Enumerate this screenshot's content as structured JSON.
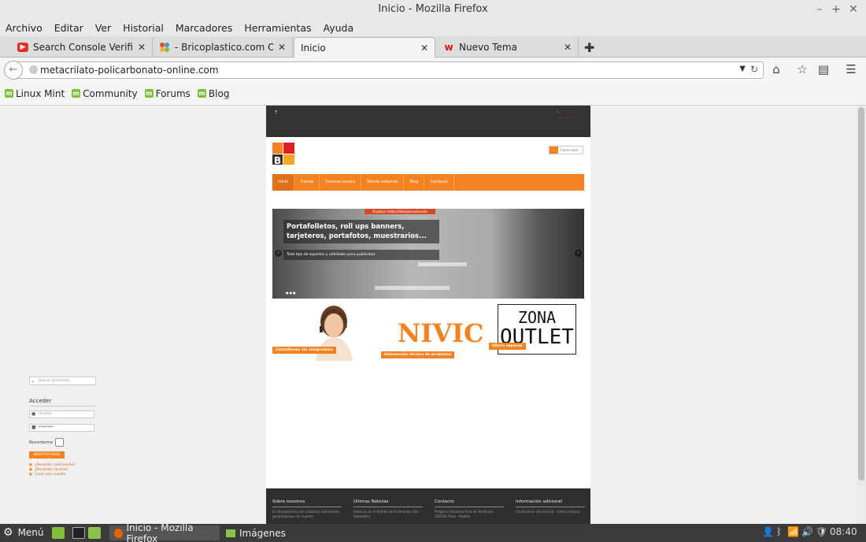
{
  "window": {
    "title": "Inicio - Mozilla Firefox"
  },
  "menubar": [
    "Archivo",
    "Editar",
    "Ver",
    "Historial",
    "Marcadores",
    "Herramientas",
    "Ayuda"
  ],
  "tabs": [
    {
      "label": "Search Console Verificar ...",
      "icon": "youtube-icon",
      "active": false
    },
    {
      "label": "- Bricoplastico.com On Li...",
      "icon": "joomla-icon",
      "active": false
    },
    {
      "label": "Inicio",
      "icon": "",
      "active": true
    },
    {
      "label": "Nuevo Tema",
      "icon": "wordpress-w-icon",
      "active": false
    }
  ],
  "url": "metacrilato-policarbonato-online.com",
  "bookmarks": [
    "Linux Mint",
    "Community",
    "Forums",
    "Blog"
  ],
  "sidebar": {
    "search_placeholder": "Buscar productos...",
    "login_title": "Acceder",
    "user_placeholder": "Usuario",
    "password_value": "•••••••",
    "remember_label": "Recordarme",
    "login_button": "IDENTIFICARSE",
    "links": [
      "¿Recordar contraseña?",
      "¿Recordar usuario?",
      "Crear una cuenta"
    ]
  },
  "site": {
    "cart_label": "Carro vacío",
    "nav": [
      "Inicio",
      "Tienda",
      "Quienes somos",
      "Dónde estamos",
      "Blog",
      "Contacto"
    ],
    "slider": {
      "ribbon": "Displays metacrilato/policarbonato",
      "headline": "Portafolletos, roll ups banners, tarjeteros, portafotos, muestrarios...",
      "subtitle": "Todo tipo de soportes y utilidades para publicidad"
    },
    "promos": [
      "Consúltenos sin compromiso",
      "Información técnica de productos",
      "Oferta especial"
    ],
    "nivic": "NIVIC",
    "outlet_line1": "ZONA",
    "outlet_line2": "OUTLET",
    "footer": [
      {
        "heading": "Sobre nosotros",
        "text": "En Bricoplastico.com plásticos industriales, garantizamos con nuestro"
      },
      {
        "heading": "Últimas Noticias",
        "text": "Aravicus en el Rombo de la Derecha (San Sebastián)"
      },
      {
        "heading": "Contacto",
        "text": "Polígono Industrial Área de Andalucía (28320) Pinto - Madrid"
      },
      {
        "heading": "Información adicional",
        "text": "Condiciones del servicio · Cómo comprar"
      }
    ]
  },
  "taskbar": {
    "menu_label": "Menú",
    "windows": [
      {
        "label": "Inicio - Mozilla Firefox",
        "active": true
      },
      {
        "label": "Imágenes",
        "active": false
      }
    ],
    "clock": "08:40"
  },
  "colors": {
    "accent": "#f58220",
    "dark": "#333333",
    "taskbar": "#3b3b3b"
  }
}
